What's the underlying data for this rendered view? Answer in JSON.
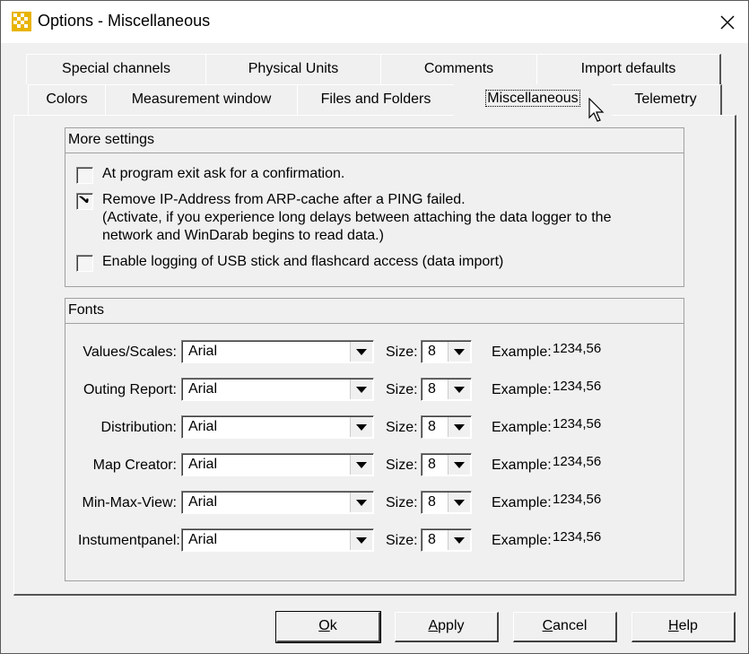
{
  "window": {
    "title": "Options - Miscellaneous"
  },
  "tabs_row1": [
    "Special channels",
    "Physical Units",
    "Comments",
    "Import defaults"
  ],
  "tabs_row2": [
    "Colors",
    "Measurement window",
    "Files and Folders",
    "Miscellaneous",
    "Telemetry"
  ],
  "active_tab": "Miscellaneous",
  "more_settings": {
    "header": "More settings",
    "options": [
      {
        "label": "At program exit ask for a confirmation.",
        "checked": false
      },
      {
        "label_lines": [
          "Remove IP-Address from ARP-cache after a PING failed.",
          "(Activate, if you experience long delays between attaching the data logger to the",
          "network and WinDarab begins to read data.)"
        ],
        "checked": true
      },
      {
        "label": "Enable logging of USB stick and flashcard access (data import)",
        "checked": false
      }
    ]
  },
  "fonts": {
    "header": "Fonts",
    "size_label": "Size:",
    "example_label": "Example:",
    "rows": [
      {
        "label": "Values/Scales:",
        "font": "Arial",
        "size": "8",
        "example": "1234,56"
      },
      {
        "label": "Outing Report:",
        "font": "Arial",
        "size": "8",
        "example": "1234,56"
      },
      {
        "label": "Distribution:",
        "font": "Arial",
        "size": "8",
        "example": "1234,56"
      },
      {
        "label": "Map Creator:",
        "font": "Arial",
        "size": "8",
        "example": "1234,56"
      },
      {
        "label": "Min-Max-View:",
        "font": "Arial",
        "size": "8",
        "example": "1234,56"
      },
      {
        "label": "Instumentpanel:",
        "font": "Arial",
        "size": "8",
        "example": "1234,56"
      }
    ]
  },
  "buttons": {
    "ok": "Ok",
    "apply": "Apply",
    "cancel": "Cancel",
    "help": "Help"
  }
}
